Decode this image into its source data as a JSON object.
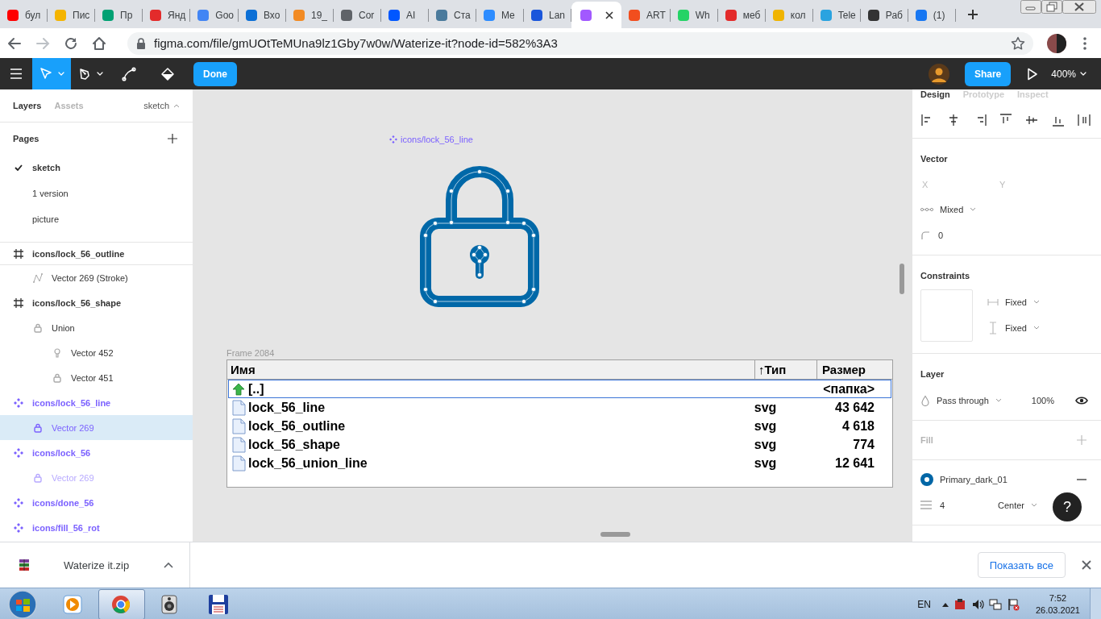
{
  "browser": {
    "tabs": [
      {
        "title": "бул",
        "selected": false,
        "color": "#ff0000"
      },
      {
        "title": "Пис",
        "selected": false,
        "color": "#f4b400"
      },
      {
        "title": "Пр",
        "selected": false,
        "color": "#00a173"
      },
      {
        "title": "Янд",
        "selected": false,
        "color": "#e32b2b"
      },
      {
        "title": "Goo",
        "selected": false,
        "color": "#4285f4"
      },
      {
        "title": "Вхо",
        "selected": false,
        "color": "#0b6fd6"
      },
      {
        "title": "19_",
        "selected": false,
        "color": "#f28b24"
      },
      {
        "title": "Cor",
        "selected": false,
        "color": "#5f6368"
      },
      {
        "title": "AI",
        "selected": false,
        "color": "#0057ff"
      },
      {
        "title": "Ста",
        "selected": false,
        "color": "#4a7a9c"
      },
      {
        "title": "Ме",
        "selected": false,
        "color": "#2d8cff"
      },
      {
        "title": "Lan",
        "selected": false,
        "color": "#1a56db"
      },
      {
        "selected": true,
        "color": "#a259ff"
      },
      {
        "title": "ART",
        "selected": false,
        "color": "#f24e1e"
      },
      {
        "title": "Wh",
        "selected": false,
        "color": "#25d366"
      },
      {
        "title": "меб",
        "selected": false,
        "color": "#e32b2b"
      },
      {
        "title": "кол",
        "selected": false,
        "color": "#f0b400"
      },
      {
        "title": "Tele",
        "selected": false,
        "color": "#2aa3e0"
      },
      {
        "title": "Раб",
        "selected": false,
        "color": "#333333"
      },
      {
        "title": "(1)",
        "selected": false,
        "color": "#1877f2"
      }
    ],
    "address_bar": {
      "url": "figma.com/file/gmUOtTeMUna9lz1Gby7w0w/Waterize-it?node-id=582%3A3"
    }
  },
  "toolbar": {
    "tools": [
      {
        "kind": "move",
        "selected": true,
        "menu": true
      },
      {
        "kind": "pen",
        "selected": false,
        "menu": true
      },
      {
        "kind": "path",
        "selected": false,
        "menu": false
      },
      {
        "kind": "fill",
        "selected": false,
        "menu": false
      }
    ],
    "done_button": "Done",
    "share_button": "Share",
    "zoom": "400%"
  },
  "layers_panel": {
    "tabs": [
      {
        "label": "Layers",
        "selected": true
      },
      {
        "label": "Assets",
        "selected": false
      }
    ],
    "page_switcher": "sketch",
    "pages_title": "Pages",
    "pages": [
      {
        "label": "sketch",
        "selected": true
      },
      {
        "label": "1 version",
        "selected": false
      },
      {
        "label": "picture",
        "selected": false
      }
    ],
    "layers": [
      {
        "kind": "frame",
        "name": "icons/lock_56_outline",
        "selected": false,
        "hidden": false,
        "children": [
          {
            "kind": "stroke",
            "name": "Vector 269 (Stroke)",
            "selected": false,
            "hidden": false
          }
        ]
      },
      {
        "kind": "frame",
        "name": "icons/lock_56_shape",
        "selected": false,
        "hidden": false,
        "children": [
          {
            "kind": "lock",
            "name": "Union",
            "selected": false,
            "hidden": false,
            "children": [
              {
                "kind": "bulb",
                "name": "Vector 452",
                "selected": false,
                "hidden": false
              },
              {
                "kind": "lock",
                "name": "Vector 451",
                "selected": false,
                "hidden": false
              }
            ]
          }
        ]
      },
      {
        "kind": "component",
        "name": "icons/lock_56_line",
        "selected": false,
        "hidden": false,
        "children": [
          {
            "kind": "lock",
            "name": "Vector 269",
            "selected": true,
            "hidden": false
          }
        ]
      },
      {
        "kind": "component",
        "name": "icons/lock_56",
        "selected": false,
        "hidden": false,
        "children": [
          {
            "kind": "lock",
            "name": "Vector 269",
            "selected": false,
            "hidden": true
          }
        ]
      },
      {
        "kind": "component",
        "name": "icons/done_56",
        "selected": false,
        "hidden": false
      },
      {
        "kind": "component",
        "name": "icons/fill_56_rot",
        "selected": false,
        "hidden": false
      }
    ]
  },
  "canvas": {
    "component_label": "icons/lock_56_line",
    "frame_label": "Frame 2084",
    "file_list": {
      "columns": [
        {
          "label": "Имя"
        },
        {
          "label": "↑Тип"
        },
        {
          "label": "Размер"
        }
      ],
      "rows": [
        {
          "kind": "parent",
          "name": "[..]",
          "size": "<папка>",
          "selected": true
        },
        {
          "kind": "file",
          "name": "lock_56_line",
          "type": "svg",
          "size": "43 642",
          "selected": false
        },
        {
          "kind": "file",
          "name": "lock_56_outline",
          "type": "svg",
          "size": "4 618",
          "selected": false
        },
        {
          "kind": "file",
          "name": "lock_56_shape",
          "type": "svg",
          "size": "774",
          "selected": false
        },
        {
          "kind": "file",
          "name": "lock_56_union_line",
          "type": "svg",
          "size": "12 641",
          "selected": false
        }
      ]
    }
  },
  "design_panel": {
    "tabs": [
      {
        "label": "Design",
        "selected": true
      },
      {
        "label": "Prototype",
        "selected": false
      },
      {
        "label": "Inspect",
        "selected": false
      }
    ],
    "vector": {
      "title": "Vector",
      "x_label": "X",
      "y_label": "Y",
      "points": "Mixed",
      "radius": "0"
    },
    "constraints": {
      "title": "Constraints",
      "horizontal": "Fixed",
      "vertical": "Fixed"
    },
    "layer": {
      "title": "Layer",
      "blend": "Pass through",
      "opacity": "100%",
      "visible": true
    },
    "fill": {
      "title": "Fill"
    },
    "stroke": {
      "style": "Primary_dark_01",
      "color": "#0066a6",
      "weight": "4",
      "align": "Center"
    },
    "help_button": "?"
  },
  "downloads": {
    "file": "Waterize it.zip",
    "show_all": "Показать все"
  },
  "taskbar": {
    "apps": [
      {
        "kind": "media",
        "selected": false
      },
      {
        "kind": "chrome",
        "selected": true
      },
      {
        "kind": "speaker",
        "selected": false
      },
      {
        "kind": "floppy",
        "selected": false
      }
    ],
    "language": "EN",
    "time": "7:52",
    "date": "26.03.2021"
  }
}
